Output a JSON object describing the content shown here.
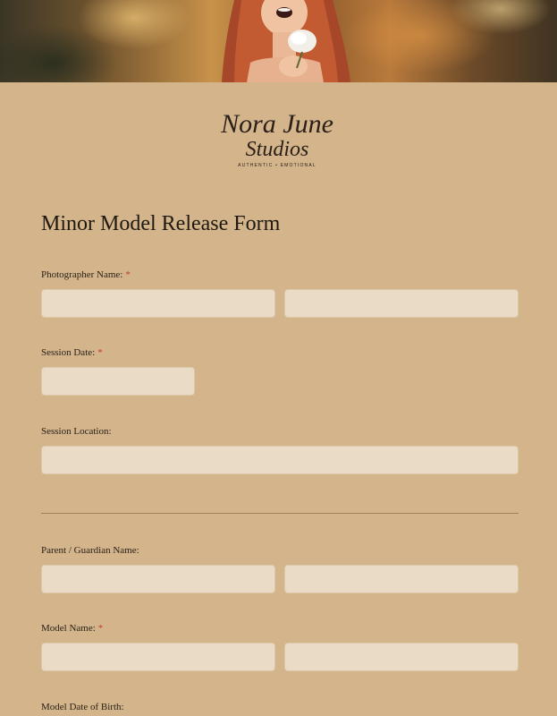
{
  "logo": {
    "line1": "Nora June",
    "line2": "Studios",
    "tagline": "AUTHENTIC • EMOTIONAL"
  },
  "form": {
    "title": "Minor Model Release Form",
    "required_mark": "*",
    "photographer_name": {
      "label": "Photographer Name:",
      "required": true,
      "first_value": "",
      "last_value": ""
    },
    "session_date": {
      "label": "Session Date:",
      "required": true,
      "value": ""
    },
    "session_location": {
      "label": "Session Location:",
      "required": false,
      "value": ""
    },
    "guardian_name": {
      "label": "Parent / Guardian Name:",
      "required": false,
      "first_value": "",
      "last_value": ""
    },
    "model_name": {
      "label": "Model Name:",
      "required": true,
      "first_value": "",
      "last_value": ""
    },
    "model_dob": {
      "label": "Model Date of Birth:",
      "required": false
    }
  },
  "colors": {
    "background": "#d3b48b",
    "field_bg": "#e9dbc6",
    "required": "#c43a2b",
    "title": "#1f1912"
  }
}
